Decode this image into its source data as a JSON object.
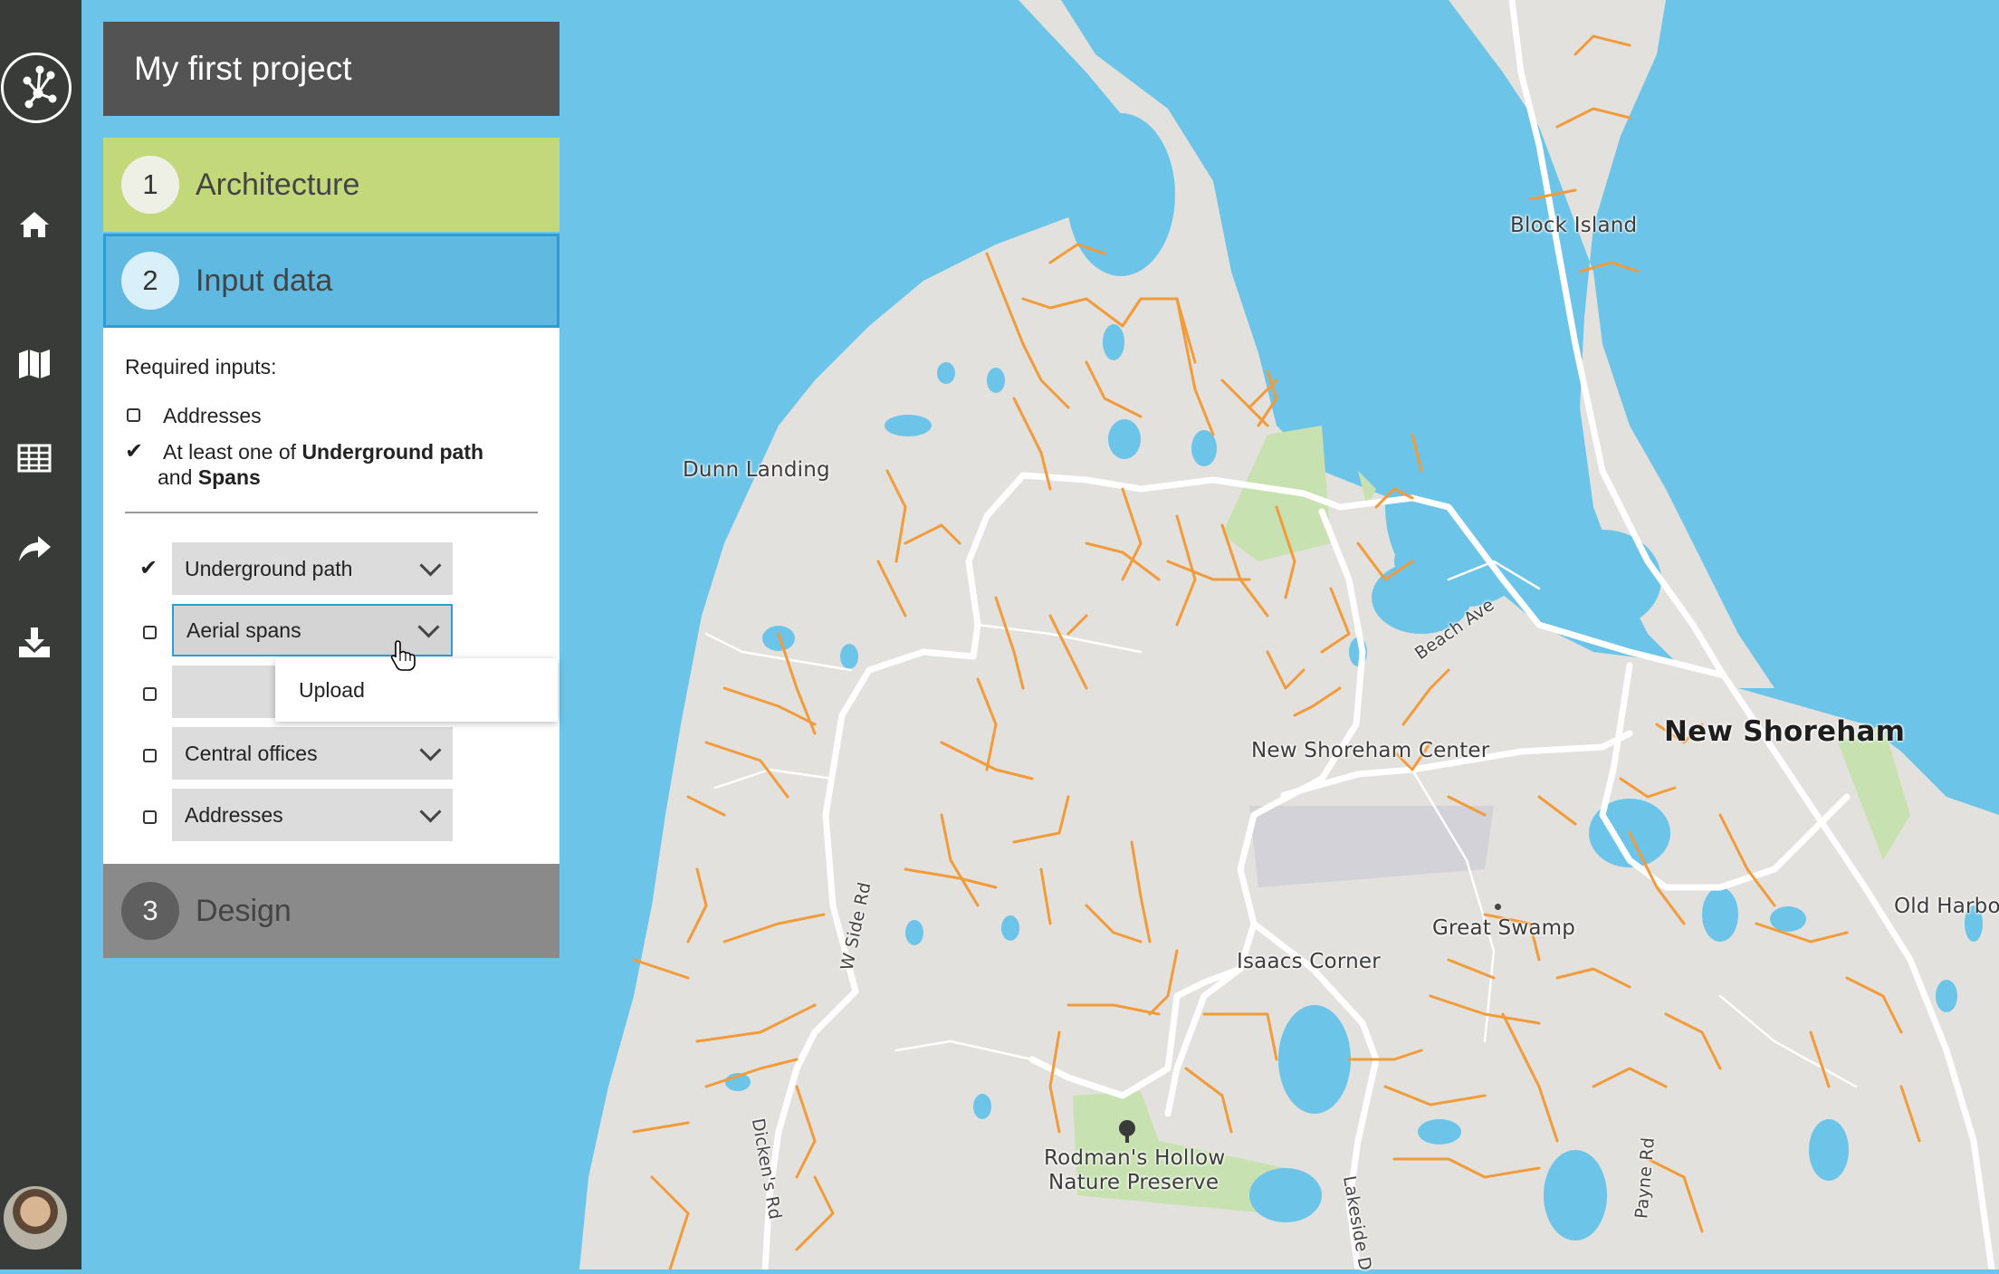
{
  "project": {
    "title": "My first project"
  },
  "steps": [
    {
      "number": "1",
      "label": "Architecture"
    },
    {
      "number": "2",
      "label": "Input data"
    },
    {
      "number": "3",
      "label": "Design"
    }
  ],
  "input_data": {
    "required_title": "Required inputs:",
    "requirement_1": "Addresses",
    "requirement_2_prefix": "At least one of ",
    "requirement_2_bold_a": "Underground path",
    "requirement_2_mid": " and ",
    "requirement_2_bold_b": "Spans",
    "rows": [
      {
        "label": "Underground path",
        "checked": true
      },
      {
        "label": "Aerial spans",
        "checked": false
      },
      {
        "label": "",
        "checked": false
      },
      {
        "label": "Central offices",
        "checked": false
      },
      {
        "label": "Addresses",
        "checked": false
      }
    ],
    "dropdown_option": "Upload"
  },
  "map": {
    "labels": {
      "block_island": "Block Island",
      "dunn_landing": "Dunn Landing",
      "new_shoreham": "New Shoreham",
      "new_shoreham_center": "New Shoreham Center",
      "great_swamp": "Great Swamp",
      "isaacs_corner": "Isaacs Corner",
      "old_harbor": "Old Harbor",
      "rodmans_hollow_1": "Rodman's Hollow",
      "rodmans_hollow_2": "Nature Preserve",
      "beach_ave": "Beach Ave",
      "w_side_rd": "W Side Rd",
      "dickens_rd": "Dicken's Rd",
      "lakeside_dr": "Lakeside D",
      "payne_rd": "Payne Rd"
    },
    "colors": {
      "water": "#6cc4e8",
      "land": "#e3e1dd",
      "path": "#f29b3a",
      "park": "#c8e1b0"
    }
  },
  "nav": {
    "icons": [
      "network-logo-icon",
      "home-icon",
      "map-icon",
      "table-icon",
      "share-icon",
      "download-icon"
    ]
  }
}
